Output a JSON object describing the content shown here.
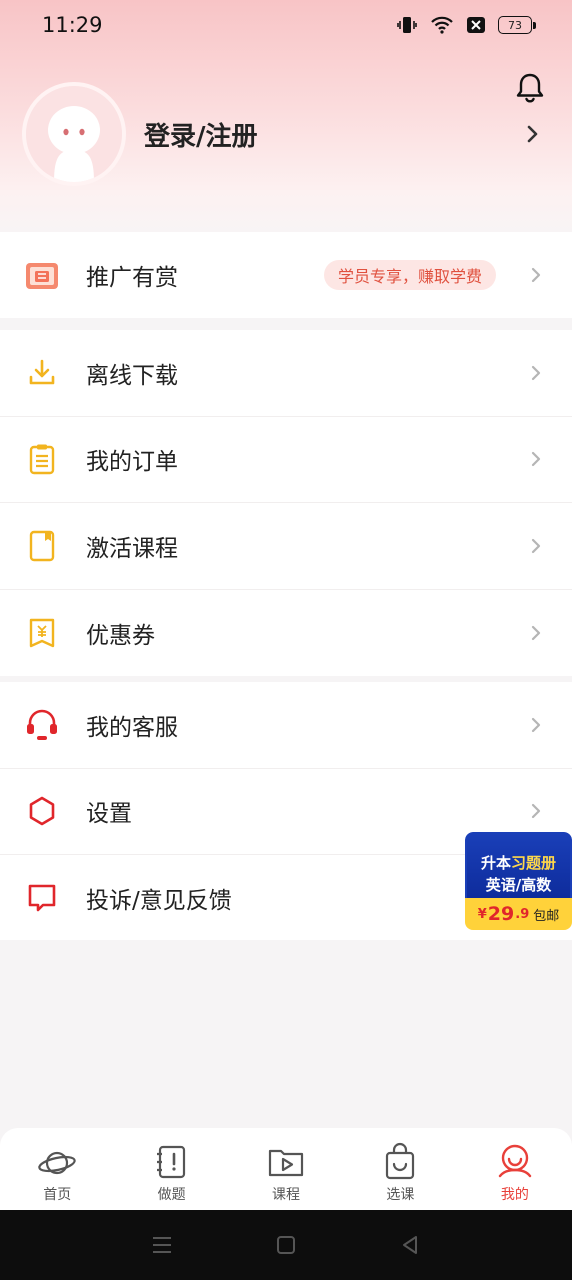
{
  "status_bar": {
    "time": "11:29",
    "battery": "73"
  },
  "profile": {
    "login_label": "登录/注册"
  },
  "promo": {
    "label": "推广有赏",
    "badge": "学员专享，赚取学费"
  },
  "menu_group_1": [
    {
      "label": "离线下载",
      "icon": "download-icon"
    },
    {
      "label": "我的订单",
      "icon": "clipboard-icon"
    },
    {
      "label": "激活课程",
      "icon": "bookmark-icon"
    },
    {
      "label": "优惠券",
      "icon": "coupon-icon"
    }
  ],
  "menu_group_2": [
    {
      "label": "我的客服",
      "icon": "headset-icon"
    },
    {
      "label": "设置",
      "icon": "hexagon-settings-icon"
    },
    {
      "label": "投诉/意见反馈",
      "icon": "feedback-icon"
    }
  ],
  "float_ad": {
    "line1_a": "升本",
    "line1_b": "习题册",
    "line2": "英语/高数",
    "currency": "¥",
    "price_int": "29",
    "price_dec": ".9",
    "shipping": "包邮"
  },
  "tabbar": [
    {
      "label": "首页",
      "icon": "planet-icon"
    },
    {
      "label": "做题",
      "icon": "exercise-book-icon"
    },
    {
      "label": "课程",
      "icon": "video-play-icon"
    },
    {
      "label": "选课",
      "icon": "shopping-bag-icon"
    },
    {
      "label": "我的",
      "icon": "profile-face-icon",
      "active": true
    }
  ],
  "colors": {
    "accent": "#e8403a",
    "icon_yellow": "#f2b41f",
    "icon_red": "#e0262b",
    "pill_bg": "#fde6e4"
  }
}
